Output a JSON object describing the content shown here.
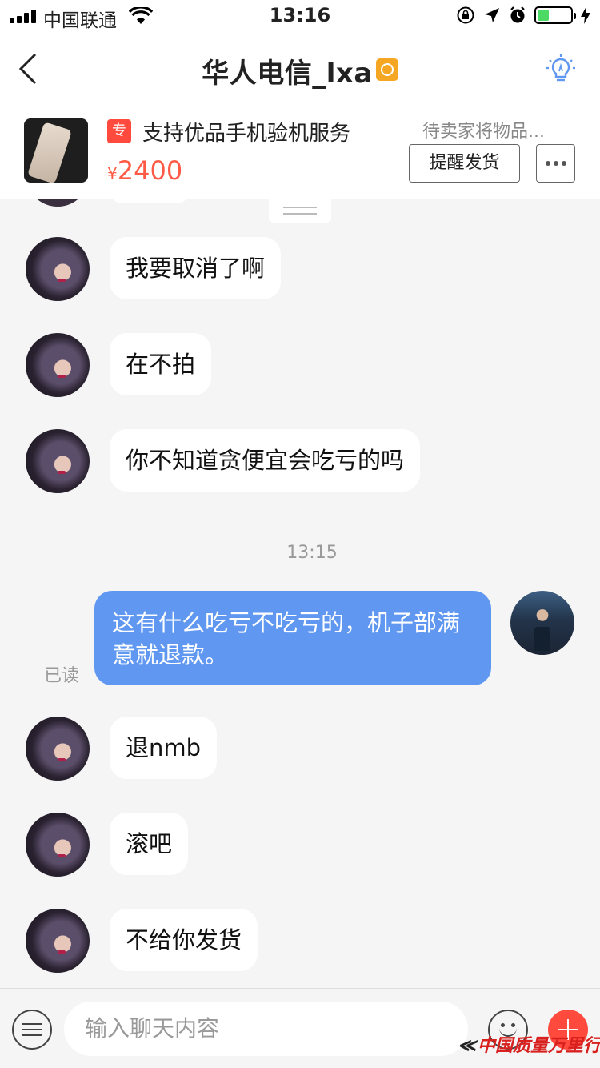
{
  "status_bar": {
    "carrier": "中国联通",
    "time": "13:16",
    "battery_level": 0.35,
    "battery_color": "#4cd964"
  },
  "header": {
    "title": "华人电信_lxa",
    "back_icon": "chevron-left-icon",
    "right_icon": "lightbulb-icon",
    "accent": "#5f97f1"
  },
  "product": {
    "tag": "专",
    "title": "支持优品手机验机服务",
    "currency": "¥",
    "price": "2400",
    "status": "待卖家将物品...",
    "remind_button": "提醒发货",
    "more_icon": "more-icon"
  },
  "messages": [
    {
      "from": "seller",
      "text": "我要取消了啊"
    },
    {
      "from": "seller",
      "text": "在不拍"
    },
    {
      "from": "seller",
      "text": "你不知道贪便宜会吃亏的吗"
    },
    {
      "type": "time",
      "text": "13:15"
    },
    {
      "from": "me",
      "text": "这有什么吃亏不吃亏的，机子部满意就退款。",
      "read": "已读"
    },
    {
      "from": "seller",
      "text": "退nmb"
    },
    {
      "from": "seller",
      "text": "滚吧"
    },
    {
      "from": "seller",
      "text": "不给你发货"
    }
  ],
  "input": {
    "placeholder": "输入聊天内容",
    "menu_icon": "menu-icon",
    "emoji_icon": "emoji-icon",
    "plus_icon": "plus-icon"
  },
  "watermark": "中国质量万里行",
  "colors": {
    "price": "#ff5a45",
    "tag": "#ff4a3d",
    "my_bubble": "#5f97f1"
  }
}
